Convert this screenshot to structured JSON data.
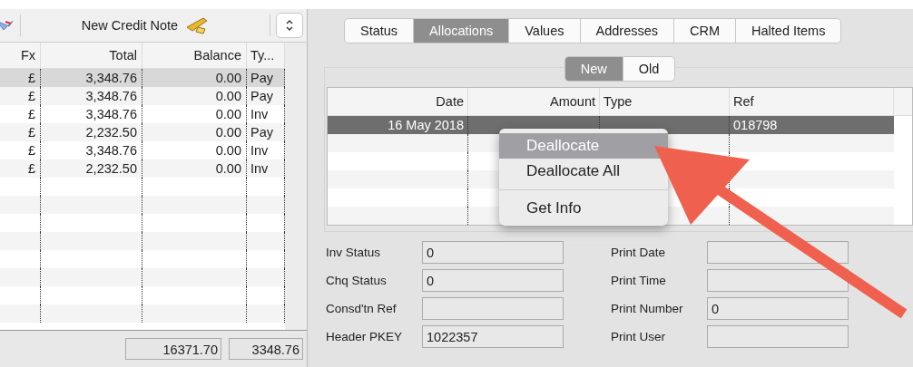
{
  "left_panel": {
    "toolbar": {
      "button": "New Credit Note"
    },
    "table": {
      "columns": [
        "Fx",
        "Total",
        "Balance",
        "Ty..."
      ],
      "rows": [
        {
          "cells": [
            "£",
            "3,348.76",
            "0.00",
            "Pay"
          ],
          "selected": true
        },
        {
          "cells": [
            "£",
            "3,348.76",
            "0.00",
            "Pay"
          ],
          "selected": false
        },
        {
          "cells": [
            "£",
            "3,348.76",
            "0.00",
            "Inv"
          ],
          "selected": false
        },
        {
          "cells": [
            "£",
            "2,232.50",
            "0.00",
            "Pay"
          ],
          "selected": false
        },
        {
          "cells": [
            "£",
            "3,348.76",
            "0.00",
            "Inv"
          ],
          "selected": false
        },
        {
          "cells": [
            "£",
            "2,232.50",
            "0.00",
            "Inv"
          ],
          "selected": false
        }
      ]
    },
    "totals": [
      "16371.70",
      "3348.76"
    ]
  },
  "tabs": [
    {
      "label": "Status",
      "selected": false
    },
    {
      "label": "Allocations",
      "selected": true
    },
    {
      "label": "Values",
      "selected": false
    },
    {
      "label": "Addresses",
      "selected": false
    },
    {
      "label": "CRM",
      "selected": false
    },
    {
      "label": "Halted Items",
      "selected": false
    }
  ],
  "segments": [
    {
      "label": "New",
      "selected": true
    },
    {
      "label": "Old",
      "selected": false
    }
  ],
  "allocations": {
    "columns": [
      "Date",
      "Amount",
      "Type",
      "Ref"
    ],
    "rows": [
      {
        "date": "16 May 2018",
        "ref": "018798",
        "selected": true
      }
    ]
  },
  "context_menu": {
    "groups": [
      [
        {
          "label": "Deallocate",
          "selected": true
        },
        {
          "label": "Deallocate All",
          "selected": false
        }
      ],
      [
        {
          "label": "Get Info",
          "selected": false
        }
      ]
    ]
  },
  "fields_left": [
    {
      "label": "Inv Status",
      "value": "0"
    },
    {
      "label": "Chq Status",
      "value": "0"
    },
    {
      "label": "Consd'tn Ref"
    },
    {
      "label": "Header PKEY",
      "value": "1022357"
    }
  ],
  "fields_right": [
    {
      "label": "Print Date"
    },
    {
      "label": "Print Time"
    },
    {
      "label": "Print Number",
      "value": "0"
    },
    {
      "label": "Print User"
    }
  ]
}
